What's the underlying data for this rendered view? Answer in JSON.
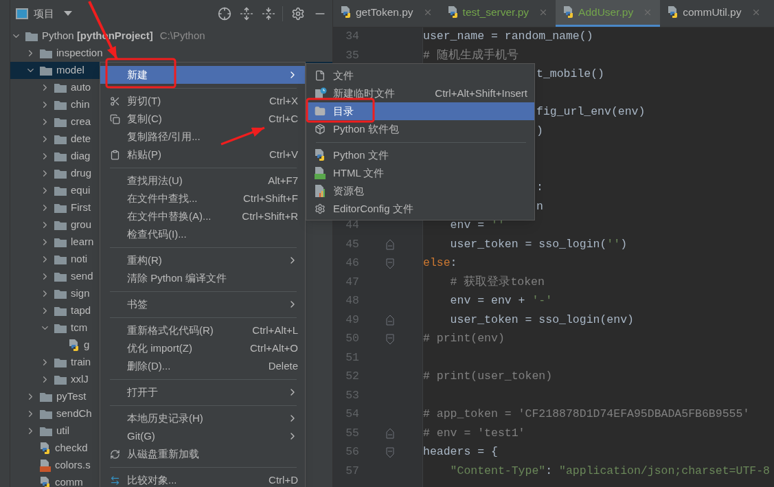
{
  "project_panel": {
    "title": "项目",
    "tree": [
      {
        "label": "Python **[pythonProject]**",
        "path": "C:\\Python",
        "kind": "folder",
        "expanded": true,
        "selected": false,
        "children": [
          {
            "label": "inspection",
            "kind": "folder",
            "expanded": false,
            "selected": false
          },
          {
            "label": "model",
            "kind": "folder",
            "expanded": true,
            "selected": true,
            "children": [
              {
                "label": "auto",
                "kind": "folder",
                "expanded": false,
                "selected": false
              },
              {
                "label": "chin",
                "kind": "folder",
                "expanded": false,
                "selected": false
              },
              {
                "label": "crea",
                "kind": "folder",
                "expanded": false,
                "selected": false
              },
              {
                "label": "dete",
                "kind": "folder",
                "expanded": false,
                "selected": false
              },
              {
                "label": "diag",
                "kind": "folder",
                "expanded": false,
                "selected": false
              },
              {
                "label": "drug",
                "kind": "folder",
                "expanded": false,
                "selected": false
              },
              {
                "label": "equi",
                "kind": "folder",
                "expanded": false,
                "selected": false
              },
              {
                "label": "First",
                "kind": "folder",
                "expanded": false,
                "selected": false
              },
              {
                "label": "grou",
                "kind": "folder",
                "expanded": false,
                "selected": false
              },
              {
                "label": "learn",
                "kind": "folder",
                "expanded": false,
                "selected": false
              },
              {
                "label": "noti",
                "kind": "folder",
                "expanded": false,
                "selected": false
              },
              {
                "label": "send",
                "kind": "folder",
                "expanded": false,
                "selected": false
              },
              {
                "label": "sign",
                "kind": "folder",
                "expanded": false,
                "selected": false
              },
              {
                "label": "tapd",
                "kind": "folder",
                "expanded": false,
                "selected": false
              },
              {
                "label": "tcm",
                "kind": "folder",
                "expanded": true,
                "selected": false,
                "children": [
                  {
                    "label": "g",
                    "kind": "python",
                    "selected": false
                  }
                ]
              },
              {
                "label": "train",
                "kind": "folder",
                "expanded": false,
                "selected": false
              },
              {
                "label": "xxlJ",
                "kind": "folder",
                "expanded": false,
                "selected": false
              }
            ]
          },
          {
            "label": "pyTest",
            "kind": "folder",
            "expanded": false,
            "selected": false
          },
          {
            "label": "sendCh",
            "kind": "folder",
            "expanded": false,
            "selected": false
          },
          {
            "label": "util",
            "kind": "folder",
            "expanded": false,
            "selected": false
          },
          {
            "label": "checkd",
            "kind": "python",
            "selected": false
          },
          {
            "label": "colors.s",
            "kind": "style",
            "selected": false
          },
          {
            "label": "comm",
            "kind": "python",
            "selected": false
          }
        ]
      }
    ]
  },
  "editor": {
    "tabs": [
      {
        "label": "getToken.py",
        "color": "#bbbbbb",
        "selected": false
      },
      {
        "label": "test_server.py",
        "color": "#73a54b",
        "selected": false
      },
      {
        "label": "AddUser.py",
        "color": "#73a54b",
        "selected": true
      },
      {
        "label": "commUtil.py",
        "color": "#bbbbbb",
        "selected": false
      }
    ],
    "lines": [
      {
        "number": "34",
        "code": [
          {
            "kind": "plain",
            "text": "user_name = random_name()"
          }
        ]
      },
      {
        "number": "35",
        "code": [
          {
            "kind": "comment",
            "text": "# 随机生成手机号"
          }
        ]
      },
      {
        "kind": "covered",
        "code": [
          {
            "kind": "plain",
            "text": "t_mobile()"
          }
        ]
      },
      {
        "kind": "covered"
      },
      {
        "kind": "covered",
        "code": [
          {
            "kind": "plain",
            "text": "fig_url_env(env)"
          }
        ]
      },
      {
        "kind": "covered",
        "code": [
          {
            "kind": "plain",
            "text": ")"
          }
        ]
      },
      {
        "kind": "covered"
      },
      {
        "kind": "covered"
      },
      {
        "kind": "covered",
        "code": [
          {
            "kind": "plain",
            "text": ":"
          }
        ]
      },
      {
        "kind": "covered",
        "code": [
          {
            "kind": "plain",
            "text": "n"
          }
        ]
      },
      {
        "number": "44",
        "code": [
          {
            "kind": "plain",
            "text": "    env = "
          },
          {
            "kind": "string",
            "text": "''"
          }
        ]
      },
      {
        "number": "45",
        "block_end": true,
        "code": [
          {
            "kind": "plain",
            "text": "    user_token = sso_login("
          },
          {
            "kind": "string",
            "text": "''"
          },
          {
            "kind": "plain",
            "text": ")"
          }
        ]
      },
      {
        "number": "46",
        "block_start": true,
        "code": [
          {
            "kind": "keyword",
            "text": "else"
          },
          {
            "kind": "plain",
            "text": ":"
          }
        ]
      },
      {
        "number": "47",
        "code": [
          {
            "kind": "comment",
            "text": "    # 获取登录token"
          }
        ]
      },
      {
        "number": "48",
        "code": [
          {
            "kind": "plain",
            "text": "    env = env + "
          },
          {
            "kind": "string",
            "text": "'-'"
          }
        ]
      },
      {
        "number": "49",
        "block_end": true,
        "code": [
          {
            "kind": "plain",
            "text": "    user_token = sso_login(env)"
          }
        ]
      },
      {
        "number": "50",
        "block_start": true,
        "code": [
          {
            "kind": "comment",
            "text": "# print(env)"
          }
        ]
      },
      {
        "number": "51"
      },
      {
        "number": "52",
        "code": [
          {
            "kind": "comment",
            "text": "# print(user_token)"
          }
        ]
      },
      {
        "number": "53"
      },
      {
        "number": "54",
        "code": [
          {
            "kind": "comment",
            "text": "# app_token = 'CF218878D1D74EFA95DBADA5FB6B9555'"
          }
        ]
      },
      {
        "number": "55",
        "block_end": true,
        "code": [
          {
            "kind": "comment",
            "text": "# env = 'test1'"
          }
        ]
      },
      {
        "number": "56",
        "block_start": true,
        "code": [
          {
            "kind": "plain",
            "text": "headers = {"
          }
        ]
      },
      {
        "number": "57",
        "code": [
          {
            "kind": "string",
            "text": "    \"Content-Type\""
          },
          {
            "kind": "plain",
            "text": ": "
          },
          {
            "kind": "string",
            "text": "\"application/json;charset=UTF-8"
          }
        ]
      }
    ]
  },
  "context_menu": {
    "items": [
      {
        "kind": "item",
        "label": "新建",
        "submenu": true,
        "selected": true
      },
      {
        "kind": "separator"
      },
      {
        "kind": "item",
        "label": "剪切(T)",
        "shortcut": "Ctrl+X",
        "selected": false
      },
      {
        "kind": "item",
        "label": "复制(C)",
        "shortcut": "Ctrl+C",
        "selected": false
      },
      {
        "kind": "item",
        "label": "复制路径/引用...",
        "selected": false
      },
      {
        "kind": "item",
        "label": "粘贴(P)",
        "shortcut": "Ctrl+V",
        "selected": false
      },
      {
        "kind": "separator"
      },
      {
        "kind": "item",
        "label": "查找用法(U)",
        "shortcut": "Alt+F7",
        "selected": false
      },
      {
        "kind": "item",
        "label": "在文件中查找...",
        "shortcut": "Ctrl+Shift+F",
        "selected": false
      },
      {
        "kind": "item",
        "label": "在文件中替换(A)...",
        "shortcut": "Ctrl+Shift+R",
        "selected": false
      },
      {
        "kind": "item",
        "label": "检查代码(I)...",
        "selected": false
      },
      {
        "kind": "separator"
      },
      {
        "kind": "item",
        "label": "重构(R)",
        "submenu": true,
        "selected": false
      },
      {
        "kind": "item",
        "label": "清除 Python 编译文件",
        "selected": false
      },
      {
        "kind": "separator"
      },
      {
        "kind": "item",
        "label": "书签",
        "submenu": true,
        "selected": false
      },
      {
        "kind": "separator"
      },
      {
        "kind": "item",
        "label": "重新格式化代码(R)",
        "shortcut": "Ctrl+Alt+L",
        "selected": false
      },
      {
        "kind": "item",
        "label": "优化 import(Z)",
        "shortcut": "Ctrl+Alt+O",
        "selected": false
      },
      {
        "kind": "item",
        "label": "删除(D)...",
        "shortcut": "Delete",
        "selected": false
      },
      {
        "kind": "separator"
      },
      {
        "kind": "item",
        "label": "打开于",
        "submenu": true,
        "selected": false
      },
      {
        "kind": "separator"
      },
      {
        "kind": "item",
        "label": "本地历史记录(H)",
        "submenu": true,
        "selected": false
      },
      {
        "kind": "item",
        "label": "Git(G)",
        "submenu": true,
        "selected": false
      },
      {
        "kind": "item",
        "label": "从磁盘重新加载",
        "selected": false
      },
      {
        "kind": "separator"
      },
      {
        "kind": "item",
        "label": "比较对象...",
        "shortcut": "Ctrl+D",
        "selected": false
      }
    ]
  },
  "submenu": {
    "items": [
      {
        "kind": "item",
        "label": "文件",
        "selected": false
      },
      {
        "kind": "item",
        "label": "新建临时文件",
        "shortcut": "Ctrl+Alt+Shift+Insert",
        "selected": false
      },
      {
        "kind": "item",
        "label": "目录",
        "selected": true
      },
      {
        "kind": "item",
        "label": "Python 软件包",
        "selected": false
      },
      {
        "kind": "separator"
      },
      {
        "kind": "item",
        "label": "Python 文件",
        "selected": false
      },
      {
        "kind": "item",
        "label": "HTML 文件",
        "selected": false
      },
      {
        "kind": "item",
        "label": "资源包",
        "selected": false
      },
      {
        "kind": "item",
        "label": "EditorConfig 文件",
        "selected": false
      }
    ]
  }
}
